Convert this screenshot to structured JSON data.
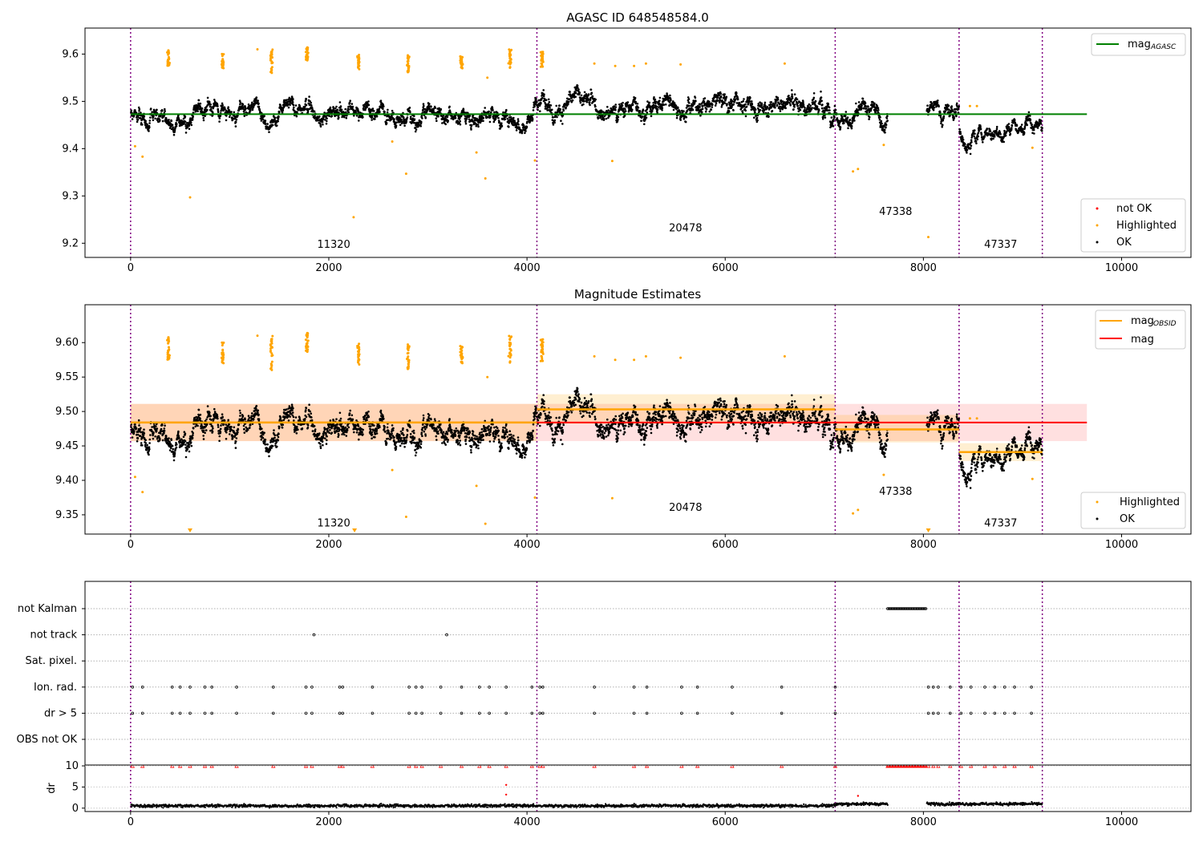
{
  "chart_data": [
    {
      "type": "scatter",
      "title": "AGASC ID 648548584.0",
      "xlim": [
        -460,
        10700
      ],
      "ylim": [
        9.17,
        9.655
      ],
      "x_ticks": [
        0,
        2000,
        4000,
        6000,
        8000,
        10000
      ],
      "y_ticks": [
        9.2,
        9.3,
        9.4,
        9.5,
        9.6
      ],
      "grid": false,
      "obs_boundaries": [
        0,
        4100,
        7110,
        8360,
        9200
      ],
      "obsid_labels": [
        {
          "text": "11320",
          "x": 2050,
          "y": 9.19
        },
        {
          "text": "20478",
          "x": 5600,
          "y": 9.225
        },
        {
          "text": "47338",
          "x": 7720,
          "y": 9.26
        },
        {
          "text": "47337",
          "x": 8780,
          "y": 9.19
        }
      ],
      "lines": [
        {
          "name": "mag",
          "sub": "AGASC",
          "color": "#008000",
          "y": 9.473,
          "x": [
            0,
            9650
          ]
        }
      ],
      "series": [
        {
          "name": "not OK",
          "color": "#ff0000"
        },
        {
          "name": "Highlighted",
          "color": "#ffa500"
        },
        {
          "name": "OK",
          "color": "#000000"
        }
      ],
      "segments": [
        {
          "x0": 0,
          "x1": 4100,
          "level": 9.478,
          "spread": 0.016
        },
        {
          "x0": 4100,
          "x1": 7110,
          "level": 9.497,
          "spread": 0.02
        },
        {
          "x0": 7110,
          "x1": 7640,
          "level": 9.472,
          "spread": 0.018
        },
        {
          "x0": 8030,
          "x1": 8360,
          "level": 9.478,
          "spread": 0.018
        },
        {
          "x0": 8360,
          "x1": 9200,
          "level": 9.44,
          "spread": 0.012
        }
      ],
      "highlighted_clusters": [
        {
          "x": 380,
          "y": [
            9.575,
            9.61
          ]
        },
        {
          "x": 930,
          "y": [
            9.57,
            9.6
          ]
        },
        {
          "x": 1420,
          "y": [
            9.56,
            9.61
          ]
        },
        {
          "x": 1780,
          "y": [
            9.58,
            9.615
          ]
        },
        {
          "x": 2300,
          "y": [
            9.565,
            9.6
          ]
        },
        {
          "x": 2800,
          "y": [
            9.56,
            9.6
          ]
        },
        {
          "x": 3340,
          "y": [
            9.57,
            9.595
          ]
        },
        {
          "x": 3830,
          "y": [
            9.57,
            9.61
          ]
        },
        {
          "x": 4150,
          "y": [
            9.57,
            9.605
          ]
        }
      ],
      "highlighted_outliers": [
        [
          45,
          9.405
        ],
        [
          120,
          9.383
        ],
        [
          600,
          9.297
        ],
        [
          1280,
          9.61
        ],
        [
          2250,
          9.255
        ],
        [
          2640,
          9.415
        ],
        [
          2780,
          9.347
        ],
        [
          3490,
          9.392
        ],
        [
          3580,
          9.337
        ],
        [
          3600,
          9.55
        ],
        [
          4080,
          9.375
        ],
        [
          4860,
          9.374
        ],
        [
          4680,
          9.58
        ],
        [
          4890,
          9.575
        ],
        [
          5080,
          9.575
        ],
        [
          5200,
          9.58
        ],
        [
          5550,
          9.578
        ],
        [
          6600,
          9.58
        ],
        [
          7290,
          9.352
        ],
        [
          7340,
          9.357
        ],
        [
          7600,
          9.408
        ],
        [
          8050,
          9.213
        ],
        [
          8470,
          9.49
        ],
        [
          8540,
          9.49
        ],
        [
          9100,
          9.402
        ]
      ]
    },
    {
      "type": "scatter",
      "title": "Magnitude Estimates",
      "xlim": [
        -460,
        10700
      ],
      "ylim": [
        9.322,
        9.655
      ],
      "x_ticks": [
        0,
        2000,
        4000,
        6000,
        8000,
        10000
      ],
      "y_ticks": [
        9.35,
        9.4,
        9.45,
        9.5,
        9.55,
        9.6
      ],
      "y_tick_labels": [
        "9.35",
        "9.40",
        "9.45",
        "9.50",
        "9.55",
        "9.60"
      ],
      "grid": false,
      "obs_boundaries": [
        0,
        4100,
        7110,
        8360,
        9200
      ],
      "obsid_labels": [
        {
          "text": "11320",
          "x": 2050,
          "y": 9.333
        },
        {
          "text": "20478",
          "x": 5600,
          "y": 9.356
        },
        {
          "text": "47338",
          "x": 7720,
          "y": 9.379
        },
        {
          "text": "47337",
          "x": 8780,
          "y": 9.333
        }
      ],
      "lines": [
        {
          "name": "mag",
          "sub": "OBSID",
          "color": "#ffa500"
        },
        {
          "name": "mag",
          "sub": "",
          "color": "#ff0000",
          "y": 9.484,
          "band": [
            9.457,
            9.511
          ],
          "x": [
            0,
            9650
          ]
        }
      ],
      "obsid_mags": [
        {
          "x0": 0,
          "x1": 4100,
          "mag": 9.484,
          "band": [
            9.457,
            9.511
          ]
        },
        {
          "x0": 4100,
          "x1": 7110,
          "mag": 9.503,
          "band": [
            9.482,
            9.525
          ]
        },
        {
          "x0": 7110,
          "x1": 8360,
          "mag": 9.474,
          "band": [
            9.455,
            9.495
          ]
        },
        {
          "x0": 8360,
          "x1": 9200,
          "mag": 9.441,
          "band": [
            9.428,
            9.454
          ]
        }
      ],
      "series": [
        {
          "name": "Highlighted",
          "color": "#ffa500"
        },
        {
          "name": "OK",
          "color": "#000000"
        }
      ],
      "off_scale_markers": [
        600,
        2260,
        8050
      ]
    },
    {
      "type": "scatter",
      "xlim": [
        -460,
        10700
      ],
      "x_ticks": [
        0,
        2000,
        4000,
        6000,
        8000,
        10000
      ],
      "flag_rows": [
        "not Kalman",
        "not track",
        "Sat. pixel.",
        "Ion. rad.",
        "dr > 5",
        "OBS not OK"
      ],
      "flags": {
        "not Kalman": [
          [
            7640,
            8030
          ]
        ],
        "not track": [
          1850,
          3190
        ],
        "Sat. pixel.": [],
        "Ion. rad.": [
          20,
          120,
          420,
          500,
          600,
          750,
          820,
          1070,
          1440,
          1770,
          1830,
          2110,
          2140,
          2440,
          2810,
          2880,
          2940,
          3130,
          3340,
          3520,
          3620,
          3790,
          4050,
          4130,
          4160,
          4680,
          5080,
          5210,
          5560,
          5720,
          6070,
          6570,
          7110,
          8050,
          8100,
          8150,
          8270,
          8380,
          8480,
          8620,
          8720,
          8820,
          8920,
          9090
        ],
        "dr > 5": [
          20,
          120,
          420,
          500,
          600,
          750,
          820,
          1070,
          1440,
          1770,
          1830,
          2110,
          2140,
          2440,
          2810,
          2880,
          2940,
          3130,
          3340,
          3520,
          3620,
          3790,
          4050,
          4130,
          4160,
          4680,
          5080,
          5210,
          5560,
          5720,
          6070,
          6570,
          7110,
          8050,
          8100,
          8150,
          8270,
          8380,
          8480,
          8620,
          8720,
          8820,
          8920,
          9090
        ],
        "OBS not OK": []
      },
      "dr_ylabel": "dr",
      "dr_yticks": [
        0,
        5,
        10
      ],
      "dr_ylim": [
        -0.8,
        10.2
      ]
    }
  ],
  "texts": {
    "legend1": {
      "not_ok": "not OK",
      "highlighted": "Highlighted",
      "ok": "OK",
      "mag": "mag",
      "mag_sub": "AGASC"
    },
    "legend2": {
      "highlighted": "Highlighted",
      "ok": "OK",
      "mag_obsid": "mag",
      "mag_obsid_sub": "OBSID",
      "mag": "mag"
    }
  }
}
